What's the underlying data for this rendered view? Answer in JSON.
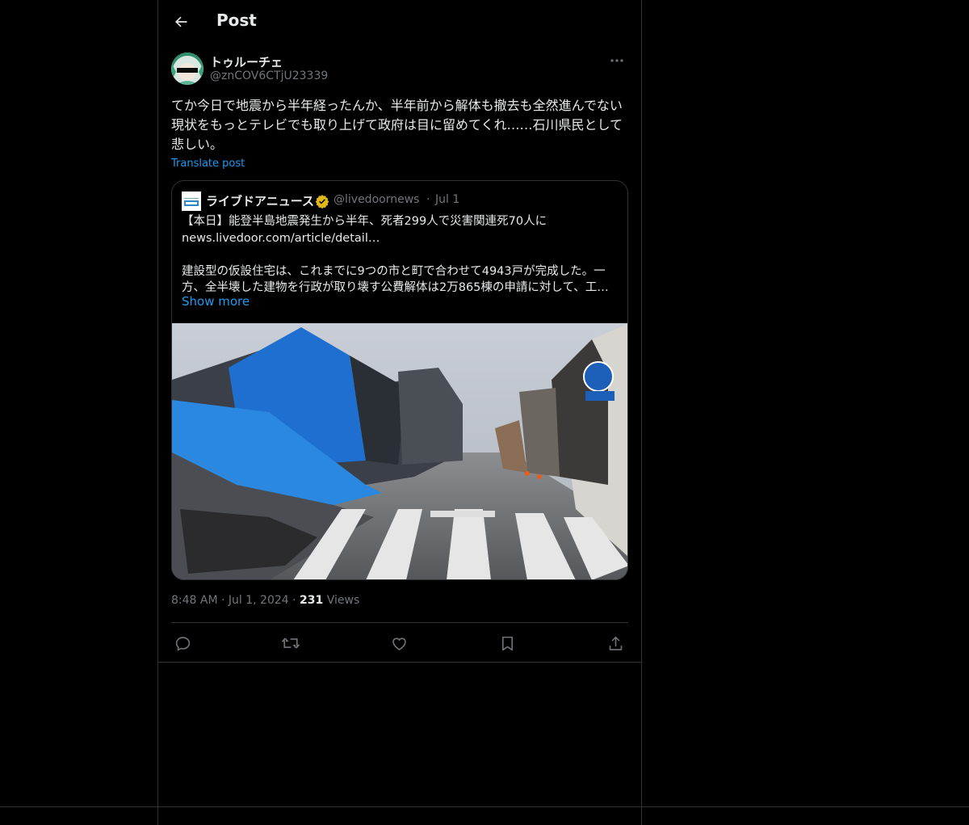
{
  "header": {
    "title": "Post",
    "back_icon": "arrow-left-icon"
  },
  "author": {
    "name": "トゥルーチェ",
    "handle": "@znCOV6CTjU23339",
    "more_icon": "more-dots-icon"
  },
  "post": {
    "text": "てか今日で地震から半年経ったんか、半年前から解体も撤去も全然進んでない現状をもっとテレビでも取り上げて政府は目に留めてくれ……石川県民として悲しい。",
    "translate_label": "Translate post"
  },
  "quote": {
    "name": "ライブドアニュース",
    "handle": "@livedoornews",
    "separator": "·",
    "date": "Jul 1",
    "lines": [
      "【本日】能登半島地震発生から半年、死者299人で災害関連死70人に",
      "news.livedoor.com/article/detail…",
      "建設型の仮設住宅は、これまでに9つの市と町で合わせて4943戸が完成した。一",
      "方、全半壊した建物を行政が取り壊す公費解体は2万865棟の申請に対して、工…"
    ],
    "show_more": "Show more"
  },
  "meta": {
    "time": "8:48 AM",
    "dot1": "·",
    "date": "Jul 1, 2024",
    "dot2": "·",
    "views_count": "231",
    "views_label": "Views"
  },
  "actions": [
    "reply-icon",
    "repost-icon",
    "like-icon",
    "bookmark-icon",
    "share-icon"
  ],
  "colors": {
    "accent": "#1d9bf0",
    "text": "#e7e9ea",
    "muted": "#71767b",
    "border": "#2f3336",
    "background": "#000000"
  }
}
